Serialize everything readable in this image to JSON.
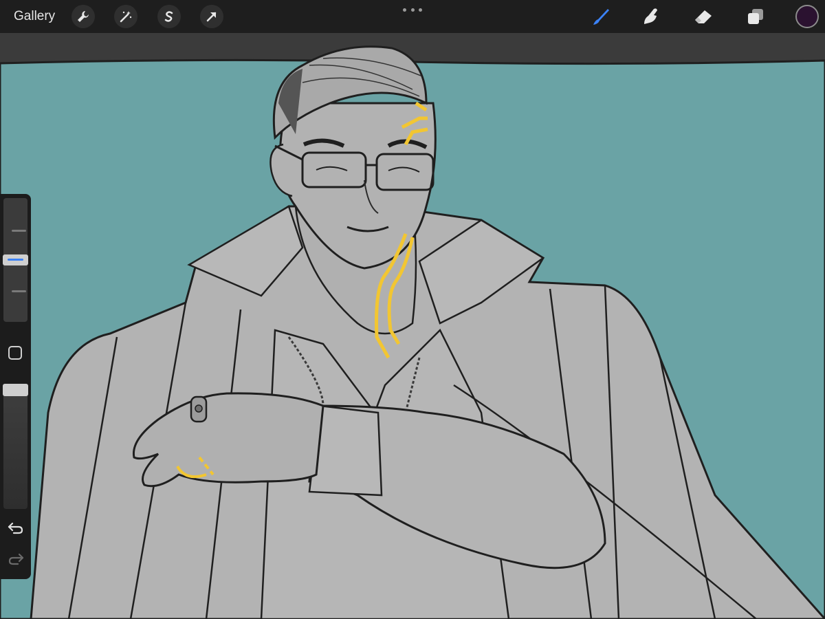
{
  "toolbar": {
    "gallery_label": "Gallery",
    "left_tools": [
      {
        "name": "actions-wrench-icon"
      },
      {
        "name": "adjustments-wand-icon"
      },
      {
        "name": "selection-s-icon"
      },
      {
        "name": "transform-arrow-icon"
      }
    ],
    "right_tools": [
      {
        "name": "brush-icon",
        "active": true
      },
      {
        "name": "smudge-icon",
        "active": false
      },
      {
        "name": "eraser-icon",
        "active": false
      },
      {
        "name": "layers-icon",
        "active": false
      }
    ],
    "current_color": "#2b1230"
  },
  "sidebar": {
    "brush_size_level": 0.5,
    "opacity_level": 0.0,
    "modify_button": "square-modify-icon",
    "undo": "undo-arrow-icon",
    "redo": "redo-arrow-icon"
  },
  "colors": {
    "accent_blue": "#3b82f6",
    "canvas_background": "#6aa3a5",
    "highlight_yellow": "#f2c632",
    "figure_fill": "#b3b3b3",
    "line_art": "#1f1f1f"
  }
}
